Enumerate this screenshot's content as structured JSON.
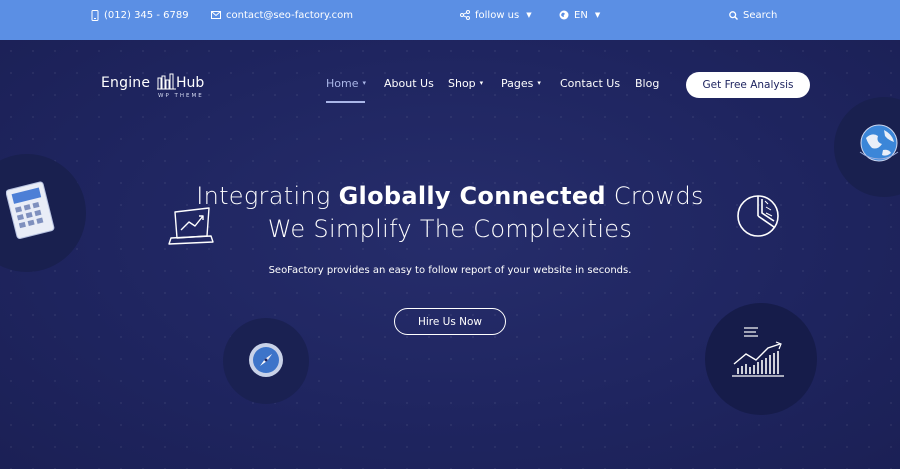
{
  "topbar": {
    "phone": "(012) 345 - 6789",
    "email": "contact@seo-factory.com",
    "follow": "follow us",
    "language": "EN",
    "search": "Search"
  },
  "logo": {
    "word1": "Engine",
    "word2": "Hub",
    "tagline": "WP THEME"
  },
  "nav": {
    "items": [
      {
        "label": "Home",
        "dropdown": true,
        "active": true
      },
      {
        "label": "About Us",
        "dropdown": false
      },
      {
        "label": "Shop",
        "dropdown": true
      },
      {
        "label": "Pages",
        "dropdown": true
      },
      {
        "label": "Contact Us",
        "dropdown": false
      },
      {
        "label": "Blog",
        "dropdown": false
      }
    ],
    "cta": "Get Free Analysis"
  },
  "hero": {
    "line1_pre": "Integrating ",
    "line1_bold": "Globally Connected",
    "line1_post": " Crowds",
    "line2": "We Simplify The Complexities",
    "description": "SeoFactory provides an easy to follow report of your website in seconds.",
    "button": "Hire Us Now"
  },
  "icons": [
    "calculator-icon",
    "globe-icon",
    "laptop-chart-icon",
    "pie-chart-icon",
    "compass-icon",
    "bar-chart-icon"
  ],
  "colors": {
    "topbar": "#5b8fe4",
    "background": "#1f2560",
    "accent": "#aab6e8"
  }
}
